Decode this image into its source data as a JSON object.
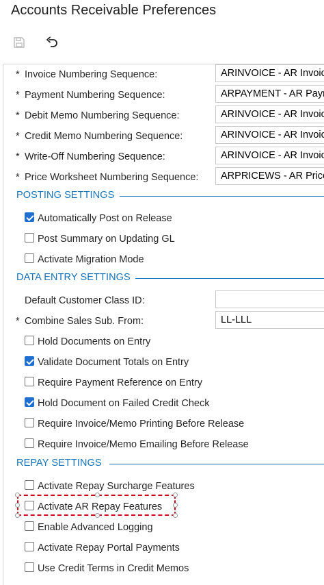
{
  "page": {
    "title": "Accounts Receivable Preferences"
  },
  "toolbar": {
    "save_icon": "save-icon",
    "undo_icon": "undo-icon"
  },
  "sequences": [
    {
      "label": "Invoice Numbering Sequence:",
      "value": "ARINVOICE - AR Invoice",
      "required": true
    },
    {
      "label": "Payment Numbering Sequence:",
      "value": "ARPAYMENT - AR Payment",
      "required": true
    },
    {
      "label": "Debit Memo Numbering Sequence:",
      "value": "ARINVOICE - AR Invoice",
      "required": true
    },
    {
      "label": "Credit Memo Numbering Sequence:",
      "value": "ARINVOICE - AR Invoice",
      "required": true
    },
    {
      "label": "Write-Off Numbering Sequence:",
      "value": "ARINVOICE - AR Invoice",
      "required": true
    },
    {
      "label": "Price Worksheet Numbering Sequence:",
      "value": "ARPRICEWS - AR Price",
      "required": true
    }
  ],
  "posting": {
    "title": "POSTING SETTINGS",
    "items": [
      {
        "label": "Automatically Post on Release",
        "checked": true
      },
      {
        "label": "Post Summary on Updating GL",
        "checked": false
      },
      {
        "label": "Activate Migration Mode",
        "checked": false
      }
    ]
  },
  "data_entry": {
    "title": "DATA ENTRY SETTINGS",
    "default_class_label": "Default Customer Class ID:",
    "default_class_value": "",
    "combine_label": "Combine Sales Sub. From:",
    "combine_value": "LL-LLL",
    "items": [
      {
        "label": "Hold Documents on Entry",
        "checked": false
      },
      {
        "label": "Validate Document Totals on Entry",
        "checked": true
      },
      {
        "label": "Require Payment Reference on Entry",
        "checked": false
      },
      {
        "label": "Hold Document on Failed Credit Check",
        "checked": true
      },
      {
        "label": "Require Invoice/Memo Printing Before Release",
        "checked": false
      },
      {
        "label": "Require Invoice/Memo Emailing Before Release",
        "checked": false
      }
    ]
  },
  "repay": {
    "title": "REPAY SETTINGS",
    "items": [
      {
        "label": "Activate Repay Surcharge Features",
        "checked": false
      },
      {
        "label": "Activate AR Repay Features",
        "checked": false
      },
      {
        "label": "Enable Advanced Logging",
        "checked": false
      },
      {
        "label": "Activate Repay Portal Payments",
        "checked": false
      },
      {
        "label": "Use Credit Terms in Credit Memos",
        "checked": false
      }
    ]
  },
  "colors": {
    "accent": "#1473b8",
    "checkbox_on": "#1e6fd0",
    "highlight": "#d0021b"
  }
}
